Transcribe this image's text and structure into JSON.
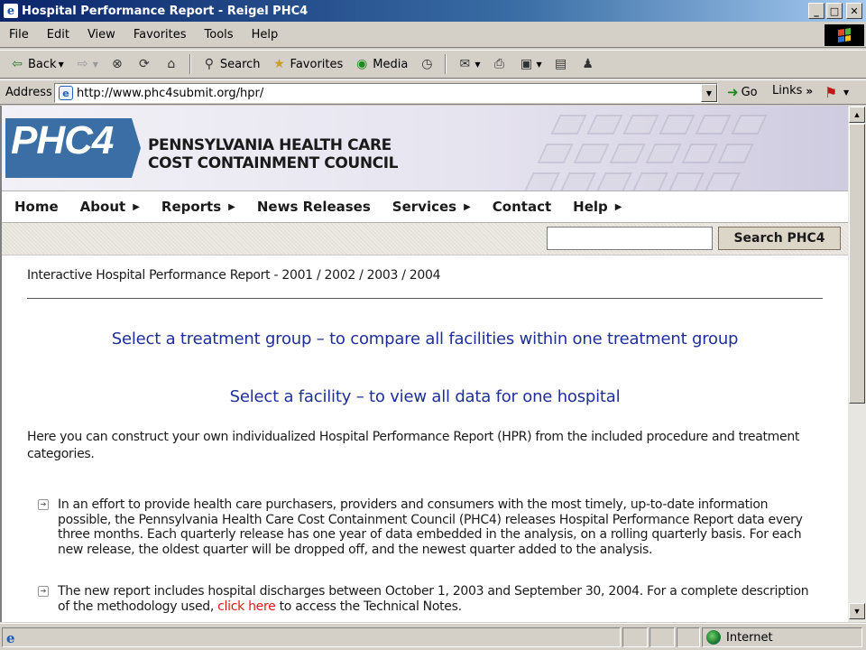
{
  "window": {
    "title": "Hospital Performance Report - Reigel PHC4",
    "buttons": {
      "minimize": "_",
      "maximize": "□",
      "close": "✕"
    }
  },
  "menu": [
    "File",
    "Edit",
    "View",
    "Favorites",
    "Tools",
    "Help"
  ],
  "toolbar": {
    "back": "Back",
    "search": "Search",
    "favorites": "Favorites",
    "media": "Media"
  },
  "address": {
    "label": "Address",
    "url": "http://www.phc4submit.org/hpr/",
    "go": "Go",
    "links": "Links"
  },
  "banner": {
    "logo": "PHC4",
    "org_line1": "PENNSYLVANIA HEALTH CARE",
    "org_line2": "COST CONTAINMENT COUNCIL"
  },
  "nav": [
    "Home",
    "About",
    "Reports",
    "News Releases",
    "Services",
    "Contact",
    "Help"
  ],
  "search": {
    "value": "",
    "button": "Search PHC4"
  },
  "page": {
    "heading": "Interactive Hospital Performance Report - 2001 / 2002 / 2003 / 2004",
    "link_treatment": "Select a treatment group – to compare all facilities within one treatment group",
    "link_facility": "Select a facility – to view all data for one hospital",
    "intro": "Here you can construct your own individualized Hospital Performance Report (HPR) from the included procedure and treatment categories.",
    "bullet1": "In an effort to provide health care purchasers, providers and consumers with the most timely, up-to-date information possible, the Pennsylvania Health Care Cost Containment Council (PHC4) releases Hospital Performance Report data every three months. Each quarterly release has one year of data embedded in the analysis, on a rolling quarterly basis. For each new release, the oldest quarter will be dropped off, and the newest quarter added to the analysis.",
    "bullet2_before": "The new report includes hospital discharges between October 1, 2003 and September 30, 2004. For a complete description of the methodology used, ",
    "bullet2_link": "click here",
    "bullet2_after": " to access the Technical Notes."
  },
  "status": {
    "zone": "Internet"
  },
  "colors": {
    "link_blue": "#1f2f9a",
    "link_red": "#e01818",
    "logo_blue": "#3a6ea5"
  }
}
